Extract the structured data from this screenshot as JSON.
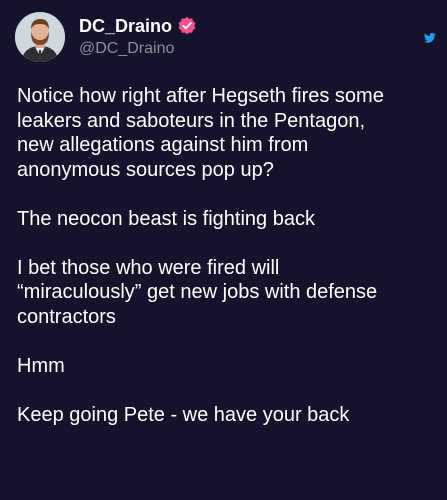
{
  "author": {
    "display_name": "DC_Draino",
    "handle": "@DC_Draino",
    "verified_icon": "verified-badge-icon",
    "avatar_icon": "avatar"
  },
  "app_icon": "bird-icon",
  "colors": {
    "background": "#15132b",
    "text": "#ffffff",
    "handle": "#8b8d9a",
    "verified_badge": "#f4518e",
    "bird_icon": "#1d9bf0"
  },
  "tweet": {
    "paragraphs": [
      "Notice how right after Hegseth fires some\nleakers and saboteurs in the Pentagon,\nnew allegations against him from\nanonymous sources pop up?",
      "The neocon beast is fighting back",
      "I bet those who were fired will\n“miraculously” get new jobs with defense\ncontractors",
      "Hmm",
      "Keep going Pete - we have your back"
    ]
  }
}
